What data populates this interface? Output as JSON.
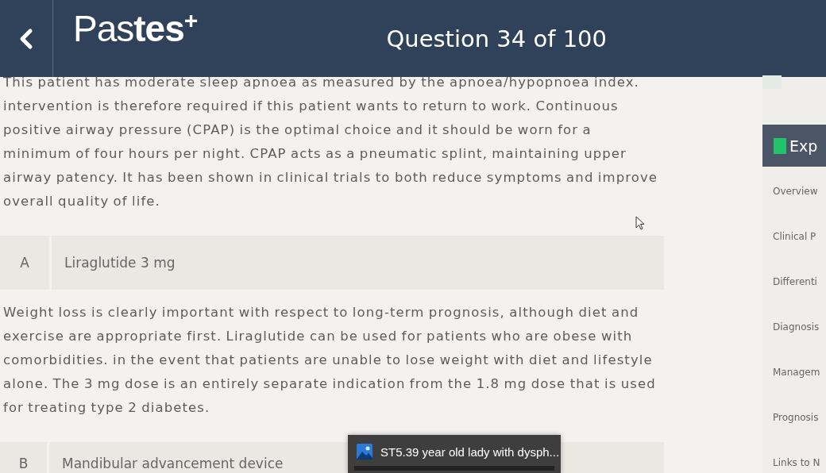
{
  "header": {
    "logo": "Pas**tes**$^{+}$",
    "title": "Question 34 of 100"
  },
  "explanation": "This patient has moderate sleep apnoea as measured by the apnoea/hypopnoea index. intervention is therefore required if this patient wants to return to work. Continuous positive airway pressure (CPAP) is the optimal choice and it should be worn for a minimum of four hours per night. CPAP acts as a pneumatic splint, maintaining upper airway patency. It has been shown in clinical trials to both reduce symptoms and improve overall quality of life.",
  "options": [
    {
      "letter": "A",
      "text": "Liraglutide 3 mg",
      "explanation": "Weight loss is clearly important with respect to long-term prognosis, although diet and exercise are appropriate first. Liraglutide can be used for patients who are obese with comorbidities. in the event that patients are unable to lose weight with diet and lifestyle alone. The 3 mg dose is an entirely separate indication from the 1.8 mg dose that is used for treating type 2 diabetes."
    },
    {
      "letter": "B",
      "text": "Mandibular advancement device"
    }
  ],
  "sidebar": {
    "header": "Exp",
    "items": [
      "Overview",
      "Clinical P",
      "Differenti",
      "Diagnosis",
      "Managem",
      "Prognosis",
      "Links to N"
    ]
  },
  "taskbar_preview": {
    "title": "ST5.39 year old lady with dysph..."
  }
}
